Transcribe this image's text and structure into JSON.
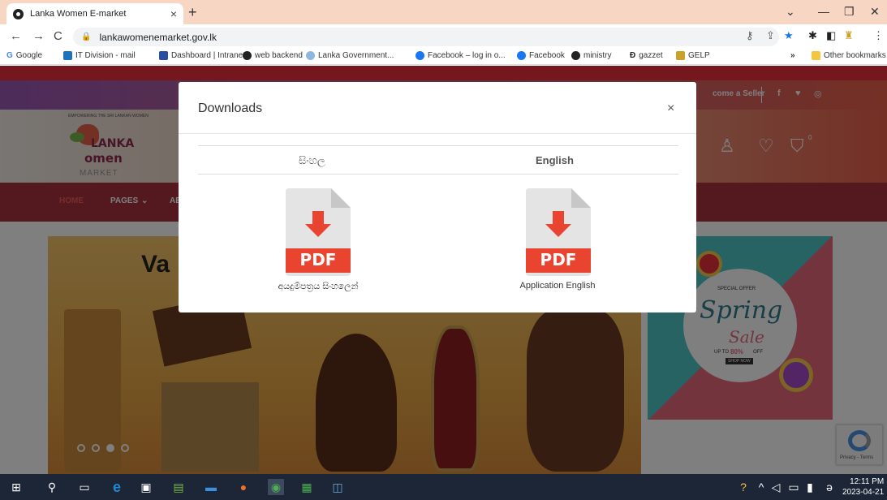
{
  "browser": {
    "tab_title": "Lanka Women E-market",
    "url": "lankawomenemarket.gov.lk",
    "bookmarks": [
      "Google",
      "IT Division - mail",
      "Dashboard | Intranet",
      "web backend",
      "Lanka Government...",
      "Facebook – log in o...",
      "Facebook",
      "ministry",
      "gazzet",
      "GELP"
    ],
    "overflow": "»",
    "other_bookmarks": "Other bookmarks"
  },
  "site": {
    "tagline": "EMPOWERING THE SRI LANKAN WOMEN",
    "logo": {
      "line1": "LANKA",
      "line2": "omen",
      "line3": "MARKET"
    },
    "become_seller": "come a Seller",
    "nav": [
      "HOME",
      "PAGES",
      "AE"
    ],
    "cart_count": "0",
    "banner_text": "Va",
    "promo": {
      "special": "SPECIAL OFFER",
      "spring": "Spring",
      "sale": "Sale",
      "upto": "UP TO",
      "percent": "80%",
      "off": "OFF",
      "shop": "SHOP NOW"
    },
    "recaptcha_links": "Privacy - Terms"
  },
  "modal": {
    "title": "Downloads",
    "close": "×",
    "col_sinhala": "සිංහල",
    "col_english": "English",
    "pdf_badge": "PDF",
    "file_sinhala": "අයදුම්පත්‍රය සිංහලෙන්",
    "file_english": "Application English"
  },
  "taskbar": {
    "time": "12:11 PM",
    "date": "2023-04-21"
  },
  "colors": {
    "accent_red": "#e8313a",
    "pdf_red": "#e8442f",
    "nav_bg": "#a8323e"
  }
}
